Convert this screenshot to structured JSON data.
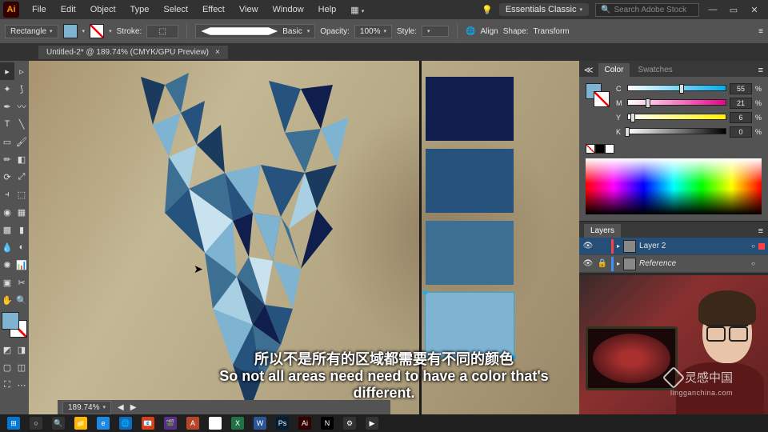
{
  "app": {
    "logo": "Ai"
  },
  "menubar": {
    "items": [
      "File",
      "Edit",
      "Object",
      "Type",
      "Select",
      "Effect",
      "View",
      "Window",
      "Help"
    ],
    "workspace": "Essentials Classic",
    "search_placeholder": "Search Adobe Stock"
  },
  "controlbar": {
    "tool_label": "Rectangle",
    "fill_color": "#7eb3d2",
    "stroke_label": "Stroke:",
    "stroke_pt_display": "▢",
    "brush_label": "Basic",
    "opacity_label": "Opacity:",
    "opacity_value": "100%",
    "style_label": "Style:",
    "align_label": "Align",
    "shape_label": "Shape:",
    "transform_label": "Transform"
  },
  "document": {
    "tab_title": "Untitled-2* @ 189.74% (CMYK/GPU Preview)",
    "zoom": "189.74%"
  },
  "palette": {
    "colors": [
      "#0f1e4d",
      "#26527e",
      "#3d6f92",
      "#7eb3d2"
    ],
    "selected_index": 3
  },
  "color_panel": {
    "tabs": [
      "Color",
      "Swatches"
    ],
    "active_tab": 0,
    "mode": "CMYK",
    "channels": [
      {
        "label": "C",
        "value": 55,
        "gradient": "linear-gradient(to right,#fff,#00aeef)"
      },
      {
        "label": "M",
        "value": 21,
        "gradient": "linear-gradient(to right,#fff,#ec008c)"
      },
      {
        "label": "Y",
        "value": 6,
        "gradient": "linear-gradient(to right,#fff,#fff200)"
      },
      {
        "label": "K",
        "value": 0,
        "gradient": "linear-gradient(to right,#fff,#000)"
      }
    ],
    "percent_symbol": "%"
  },
  "layers_panel": {
    "tab": "Layers",
    "layers": [
      {
        "name": "Layer 2",
        "visible": true,
        "locked": false,
        "color": "#ff4040",
        "selected": true
      },
      {
        "name": "Reference",
        "visible": true,
        "locked": true,
        "color": "#4090ff",
        "selected": false,
        "italic": true
      }
    ]
  },
  "subtitle": {
    "cn": "所以不是所有的区域都需要有不同的颜色",
    "en": "So not all areas need need to have a color that's different."
  },
  "watermark": {
    "text": "灵感中国",
    "sub": "lingganchina.com"
  },
  "taskbar": {
    "icons": [
      {
        "bg": "#0078d4",
        "txt": "⊞"
      },
      {
        "bg": "#333",
        "txt": "○"
      },
      {
        "bg": "#333",
        "txt": "🔍"
      },
      {
        "bg": "#ffb900",
        "txt": "📁"
      },
      {
        "bg": "#1e88e5",
        "txt": "e"
      },
      {
        "bg": "#0f6cbd",
        "txt": "🌐"
      },
      {
        "bg": "#dc3e15",
        "txt": "📧"
      },
      {
        "bg": "#5b2d8d",
        "txt": "🎬"
      },
      {
        "bg": "#b7472a",
        "txt": "A"
      },
      {
        "bg": "#fff",
        "txt": "⬇"
      },
      {
        "bg": "#217346",
        "txt": "X"
      },
      {
        "bg": "#2b579a",
        "txt": "W"
      },
      {
        "bg": "#001e36",
        "txt": "Ps"
      },
      {
        "bg": "#330000",
        "txt": "Ai"
      },
      {
        "bg": "#000",
        "txt": "N"
      },
      {
        "bg": "#333",
        "txt": "⚙"
      },
      {
        "bg": "#333",
        "txt": "▶"
      }
    ]
  }
}
